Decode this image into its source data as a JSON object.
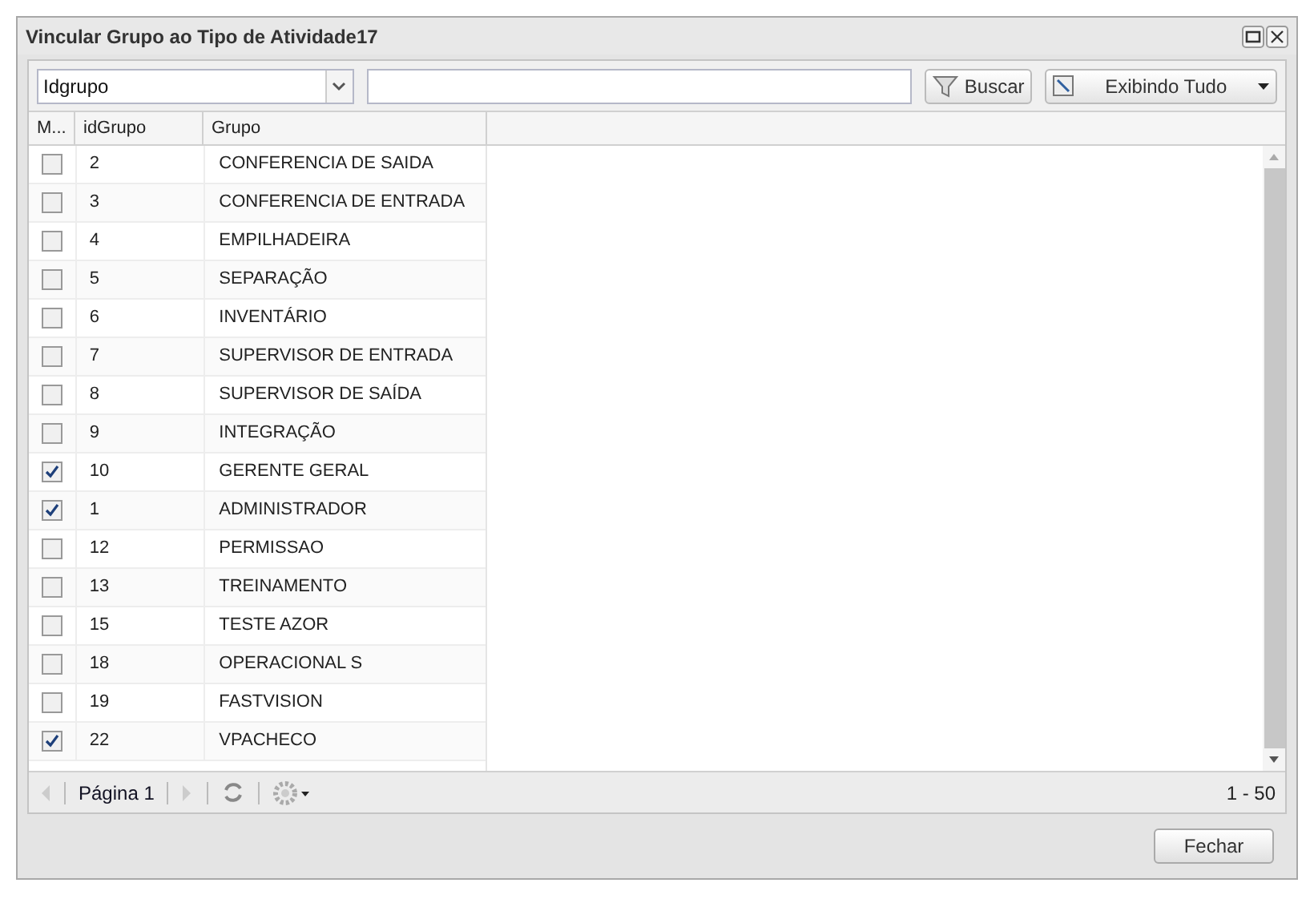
{
  "window": {
    "title": "Vincular Grupo ao Tipo de Atividade17"
  },
  "toolbar": {
    "field_select": "Idgrupo",
    "search_button": "Buscar",
    "filter_button": "Exibindo Tudo"
  },
  "table": {
    "columns": [
      "M...",
      "idGrupo",
      "Grupo"
    ],
    "rows": [
      {
        "id": "2",
        "grupo": "CONFERENCIA DE SAIDA",
        "checked": false
      },
      {
        "id": "3",
        "grupo": "CONFERENCIA DE ENTRADA",
        "checked": false
      },
      {
        "id": "4",
        "grupo": "EMPILHADEIRA",
        "checked": false
      },
      {
        "id": "5",
        "grupo": "SEPARAÇÃO",
        "checked": false
      },
      {
        "id": "6",
        "grupo": "INVENTÁRIO",
        "checked": false
      },
      {
        "id": "7",
        "grupo": "SUPERVISOR DE ENTRADA",
        "checked": false
      },
      {
        "id": "8",
        "grupo": "SUPERVISOR DE SAÍDA",
        "checked": false
      },
      {
        "id": "9",
        "grupo": "INTEGRAÇÃO",
        "checked": false
      },
      {
        "id": "10",
        "grupo": "GERENTE GERAL",
        "checked": true
      },
      {
        "id": "1",
        "grupo": "ADMINISTRADOR",
        "checked": true
      },
      {
        "id": "12",
        "grupo": "PERMISSAO",
        "checked": false
      },
      {
        "id": "13",
        "grupo": "TREINAMENTO",
        "checked": false
      },
      {
        "id": "15",
        "grupo": "TESTE AZOR",
        "checked": false
      },
      {
        "id": "18",
        "grupo": "OPERACIONAL S",
        "checked": false
      },
      {
        "id": "19",
        "grupo": "FASTVISION",
        "checked": false
      },
      {
        "id": "22",
        "grupo": "VPACHECO",
        "checked": true
      }
    ]
  },
  "paging": {
    "page": "Página 1",
    "range": "1 - 50"
  },
  "buttons": [
    "Fechar"
  ]
}
